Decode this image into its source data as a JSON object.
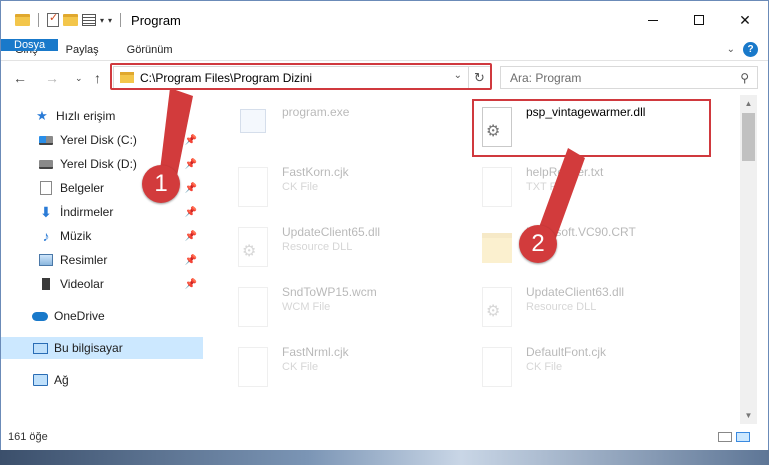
{
  "window": {
    "title": "Program",
    "tabs": [
      "Dosya",
      "Giriş",
      "Paylaş",
      "Görünüm"
    ]
  },
  "address": {
    "path": "C:\\Program Files\\Program Dizini",
    "search_placeholder": "Ara: Program"
  },
  "sidebar": {
    "items": [
      {
        "label": "Hızlı erişim",
        "icon": "star-icon"
      },
      {
        "label": "Yerel Disk (C:)",
        "icon": "disk-icon"
      },
      {
        "label": "Yerel Disk (D:)",
        "icon": "disk-icon"
      },
      {
        "label": "Belgeler",
        "icon": "document-icon"
      },
      {
        "label": "İndirmeler",
        "icon": "download-icon"
      },
      {
        "label": "Müzik",
        "icon": "music-icon"
      },
      {
        "label": "Resimler",
        "icon": "pictures-icon"
      },
      {
        "label": "Videolar",
        "icon": "video-icon"
      },
      {
        "label": "OneDrive",
        "icon": "cloud-icon"
      },
      {
        "label": "Bu bilgisayar",
        "icon": "computer-icon"
      },
      {
        "label": "Ağ",
        "icon": "network-icon"
      }
    ]
  },
  "files": [
    {
      "name": "program.exe",
      "type": ""
    },
    {
      "name": "psp_vintagewarmer.dll",
      "type": ""
    },
    {
      "name": "FastKorn.cjk",
      "type": "CK File"
    },
    {
      "name": "helpReader.txt",
      "type": "TXT File"
    },
    {
      "name": "UpdateClient65.dll",
      "type": "Resource DLL"
    },
    {
      "name": "Microsoft.VC90.CRT",
      "type": ""
    },
    {
      "name": "SndToWP15.wcm",
      "type": "WCM File"
    },
    {
      "name": "UpdateClient63.dll",
      "type": "Resource DLL"
    },
    {
      "name": "FastNrml.cjk",
      "type": "CK File"
    },
    {
      "name": "DefaultFont.cjk",
      "type": "CK File"
    }
  ],
  "status": {
    "item_count": "161 öğe"
  },
  "callouts": [
    "1",
    "2"
  ],
  "colors": {
    "accent": "#1979ca",
    "highlight": "#d0393e"
  }
}
